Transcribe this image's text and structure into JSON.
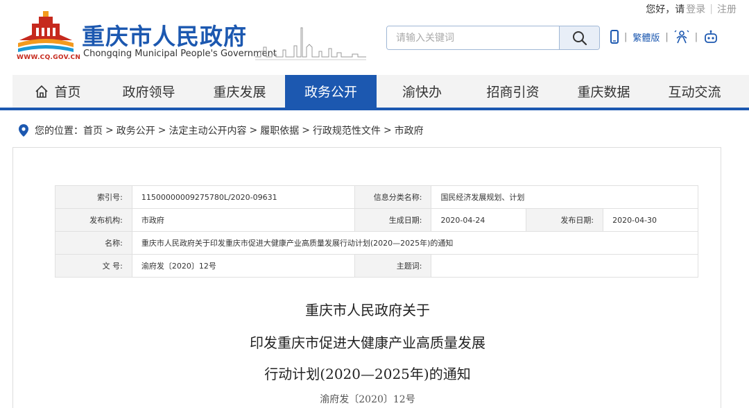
{
  "userbar": {
    "greeting": "您好，请",
    "login": "登录",
    "register": "注册"
  },
  "header": {
    "logo_url_text": "WWW.CQ.GOV.CN",
    "title": "重庆市人民政府",
    "subtitle": "Chongqing Municipal People's Government",
    "search_placeholder": "请输入关键词",
    "traditional_label": "繁體版",
    "icons": [
      "mobile-icon",
      "search-icon",
      "elder-care-icon",
      "robot-icon"
    ]
  },
  "nav": {
    "items": [
      {
        "label": "首页",
        "active": false
      },
      {
        "label": "政府领导",
        "active": false
      },
      {
        "label": "重庆发展",
        "active": false
      },
      {
        "label": "政务公开",
        "active": true
      },
      {
        "label": "渝快办",
        "active": false
      },
      {
        "label": "招商引资",
        "active": false
      },
      {
        "label": "重庆数据",
        "active": false
      },
      {
        "label": "互动交流",
        "active": false
      }
    ]
  },
  "breadcrumb": {
    "prefix": "您的位置：",
    "items": [
      "首页",
      "政务公开",
      "法定主动公开内容",
      "履职依据",
      "行政规范性文件",
      "市政府"
    ]
  },
  "meta": {
    "index_label": "索引号:",
    "index_value": "11500000009275780L/2020-09631",
    "category_label": "信息分类名称:",
    "category_value": "国民经济发展规划、计划",
    "org_label": "发布机构:",
    "org_value": "市政府",
    "created_label": "生成日期:",
    "created_value": "2020-04-24",
    "published_label": "发布日期:",
    "published_value": "2020-04-30",
    "name_label": "名称:",
    "name_value": "重庆市人民政府关于印发重庆市促进大健康产业高质量发展行动计划(2020—2025年)的通知",
    "docno_label": "文 号:",
    "docno_value": "渝府发〔2020〕12号",
    "topic_label": "主题词:",
    "topic_value": ""
  },
  "document": {
    "title_line1": "重庆市人民政府关于",
    "title_line2": "印发重庆市促进大健康产业高质量发展",
    "title_line3": "行动计划(2020—2025年)的通知",
    "doc_number": "渝府发〔2020〕12号"
  },
  "colors": {
    "brand_blue": "#1c58b0",
    "logo_red": "#c62a1e",
    "logo_orange": "#f39a1e"
  }
}
